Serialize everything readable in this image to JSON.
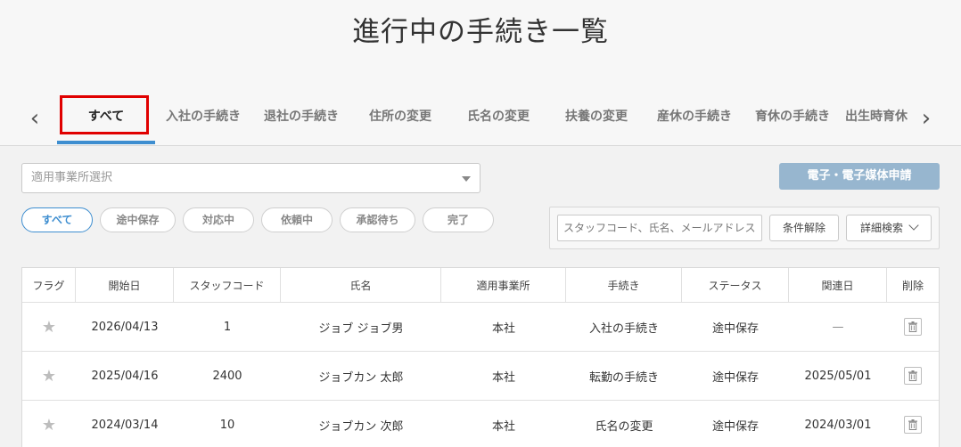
{
  "page": {
    "title": "進行中の手続き一覧"
  },
  "tabs": [
    {
      "label": "すべて",
      "active": true
    },
    {
      "label": "入社の手続き"
    },
    {
      "label": "退社の手続き"
    },
    {
      "label": "住所の変更"
    },
    {
      "label": "氏名の変更"
    },
    {
      "label": "扶養の変更"
    },
    {
      "label": "産休の手続き"
    },
    {
      "label": "育休の手続き"
    },
    {
      "label": "出生時育休"
    }
  ],
  "tab_nav": {
    "prev": "‹",
    "next": "›"
  },
  "filters": {
    "office_select_placeholder": "適用事業所選択",
    "apply_button": "電子・電子媒体申請",
    "status_chips": [
      "すべて",
      "途中保存",
      "対応中",
      "依頼中",
      "承認待ち",
      "完了"
    ],
    "search_placeholder": "スタッフコード、氏名、メールアドレス",
    "clear_button": "条件解除",
    "detail_search_button": "詳細検索"
  },
  "table": {
    "columns": [
      "フラグ",
      "開始日",
      "スタッフコード",
      "氏名",
      "適用事業所",
      "手続き",
      "ステータス",
      "関連日",
      "削除"
    ],
    "rows": [
      {
        "start": "2026/04/13",
        "code": "1",
        "name": "ジョブ ジョブ男",
        "office": "本社",
        "procedure": "入社の手続き",
        "status": "途中保存",
        "related": "—"
      },
      {
        "start": "2025/04/16",
        "code": "2400",
        "name": "ジョブカン 太郎",
        "office": "本社",
        "procedure": "転勤の手続き",
        "status": "途中保存",
        "related": "2025/05/01"
      },
      {
        "start": "2024/03/14",
        "code": "10",
        "name": "ジョブカン 次郎",
        "office": "本社",
        "procedure": "氏名の変更",
        "status": "途中保存",
        "related": "2024/03/01"
      }
    ]
  },
  "colors": {
    "accent": "#3e8ed0",
    "highlight": "#e00000",
    "apply_button": "#97b6cf"
  }
}
